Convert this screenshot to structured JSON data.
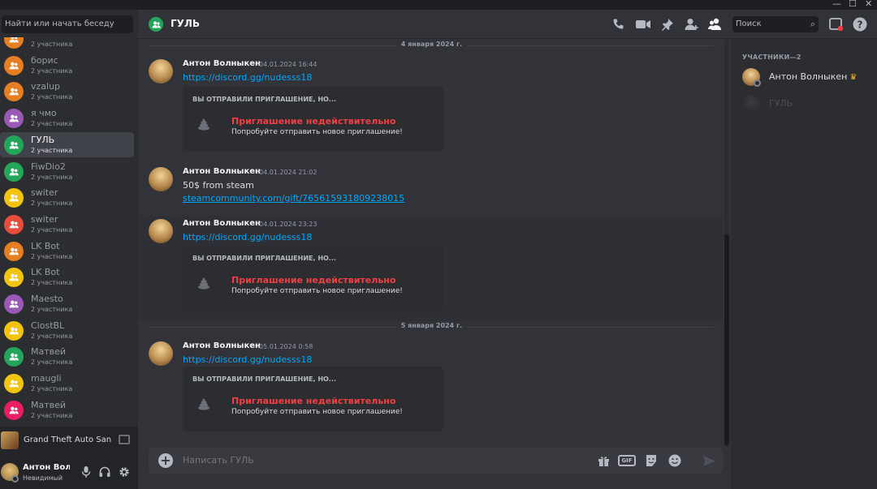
{
  "window": {
    "minimize": "—",
    "maximize": "☐",
    "close": "✕"
  },
  "sidebar": {
    "search_placeholder": "Найти или начать беседу",
    "dms": [
      {
        "name": "",
        "sub": "2 участника",
        "color": "#e67e22"
      },
      {
        "name": "борис",
        "sub": "2 участника",
        "color": "#e67e22"
      },
      {
        "name": "vzalup",
        "sub": "2 участника",
        "color": "#e67e22"
      },
      {
        "name": "я чмо",
        "sub": "2 участника",
        "color": "#9b59b6"
      },
      {
        "name": "ГУЛЬ",
        "sub": "2 участника",
        "color": "#23a55a",
        "active": true
      },
      {
        "name": "FiwDio2",
        "sub": "2 участника",
        "color": "#23a55a"
      },
      {
        "name": "switer",
        "sub": "2 участника",
        "color": "#f1c40f"
      },
      {
        "name": "switer",
        "sub": "2 участника",
        "color": "#e74c3c"
      },
      {
        "name": "LK Bot",
        "sub": "2 участника",
        "color": "#e67e22"
      },
      {
        "name": "LK Bot",
        "sub": "2 участника",
        "color": "#f1c40f"
      },
      {
        "name": "Maesto",
        "sub": "2 участника",
        "color": "#9b59b6"
      },
      {
        "name": "ClostBL",
        "sub": "2 участника",
        "color": "#f1c40f"
      },
      {
        "name": "Матвей",
        "sub": "2 участника",
        "color": "#23a55a"
      },
      {
        "name": "maugli",
        "sub": "2 участника",
        "color": "#f1c40f"
      },
      {
        "name": "Матвей",
        "sub": "2 участника",
        "color": "#e91e63"
      }
    ],
    "activity": {
      "game": "Grand Theft Auto San ..."
    },
    "user": {
      "name": "Антон Вол...",
      "status": "Невидимый"
    }
  },
  "header": {
    "title": "ГУЛЬ",
    "search_placeholder": "Поиск"
  },
  "messages": {
    "dividers": [
      "4 января 2024 г.",
      "5 января 2024 г."
    ],
    "items": [
      {
        "author": "Антон Волныкен",
        "time": "04.01.2024 16:44",
        "link": "https://discord.gg/nudesss18",
        "invite": {
          "header": "ВЫ ОТПРАВИЛИ ПРИГЛАШЕНИЕ, НО...",
          "title": "Приглашение недействительно",
          "subtitle": "Попробуйте отправить новое приглашение!"
        }
      },
      {
        "author": "Антон Волныкен",
        "time": "04.01.2024 21:02",
        "text": "50$ from steam",
        "link": "steamcommunity.com/gift/765615931809238015"
      },
      {
        "author": "Антон Волныкен",
        "time": "04.01.2024 23:23",
        "link": "https://discord.gg/nudesss18",
        "invite": {
          "header": "ВЫ ОТПРАВИЛИ ПРИГЛАШЕНИЕ, НО...",
          "title": "Приглашение недействительно",
          "subtitle": "Попробуйте отправить новое приглашение!"
        }
      },
      {
        "author": "Антон Волныкен",
        "time": "05.01.2024 0:58",
        "link": "https://discord.gg/nudesss18",
        "invite": {
          "header": "ВЫ ОТПРАВИЛИ ПРИГЛАШЕНИЕ, НО...",
          "title": "Приглашение недействительно",
          "subtitle": "Попробуйте отправить новое приглашение!"
        }
      }
    ]
  },
  "composer": {
    "placeholder": "Написать ГУЛЬ",
    "gif_label": "GIF"
  },
  "members": {
    "heading": "УЧАСТНИКИ—2",
    "list": [
      {
        "name": "Антон Волныкен",
        "owner_badge": "♛",
        "color": "#dbdee1"
      },
      {
        "name": "ГУЛЬ",
        "color": "#4e5058"
      }
    ]
  },
  "colors": {
    "accent_green": "#23a55a",
    "link": "#00a8fc",
    "error": "#f23f42"
  }
}
